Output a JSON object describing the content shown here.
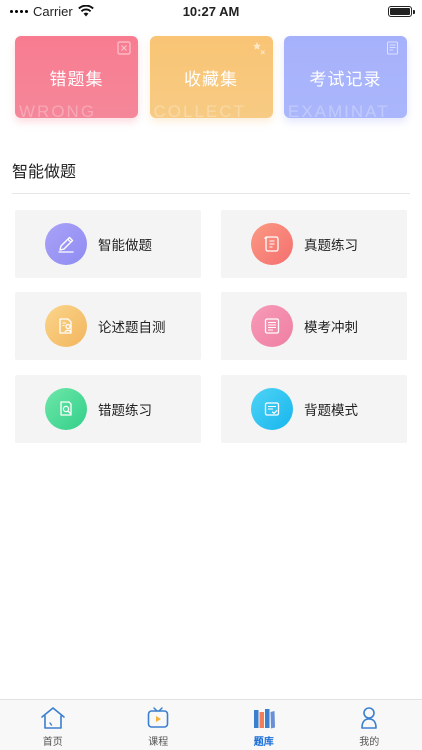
{
  "status_bar": {
    "carrier": "Carrier",
    "time": "10:27 AM"
  },
  "top_cards": [
    {
      "label": "错题集",
      "watermark": "WRONG",
      "color": "#f87c90"
    },
    {
      "label": "收藏集",
      "watermark": "COLLECT",
      "color": "#f9c474"
    },
    {
      "label": "考试记录",
      "watermark": "EXAMINAT",
      "color": "#a6b1fb"
    }
  ],
  "section": {
    "title": "智能做题"
  },
  "grid": [
    {
      "label": "智能做题",
      "icon": "pencil-icon",
      "color": "#9a96f5"
    },
    {
      "label": "真题练习",
      "icon": "scroll-icon",
      "color": "#f7837a"
    },
    {
      "label": "论述题自测",
      "icon": "person-doc-icon",
      "color": "#f5c46f"
    },
    {
      "label": "模考冲刺",
      "icon": "document-icon",
      "color": "#f28bad"
    },
    {
      "label": "错题练习",
      "icon": "search-doc-icon",
      "color": "#45d898"
    },
    {
      "label": "背题模式",
      "icon": "checklist-icon",
      "color": "#2ec2f1"
    }
  ],
  "tab_bar": {
    "active": "题库",
    "tabs": [
      {
        "label": "首页",
        "icon": "home-icon"
      },
      {
        "label": "课程",
        "icon": "play-icon"
      },
      {
        "label": "题库",
        "icon": "books-icon"
      },
      {
        "label": "我的",
        "icon": "user-icon"
      }
    ],
    "active_color": "#1d6fd8"
  }
}
